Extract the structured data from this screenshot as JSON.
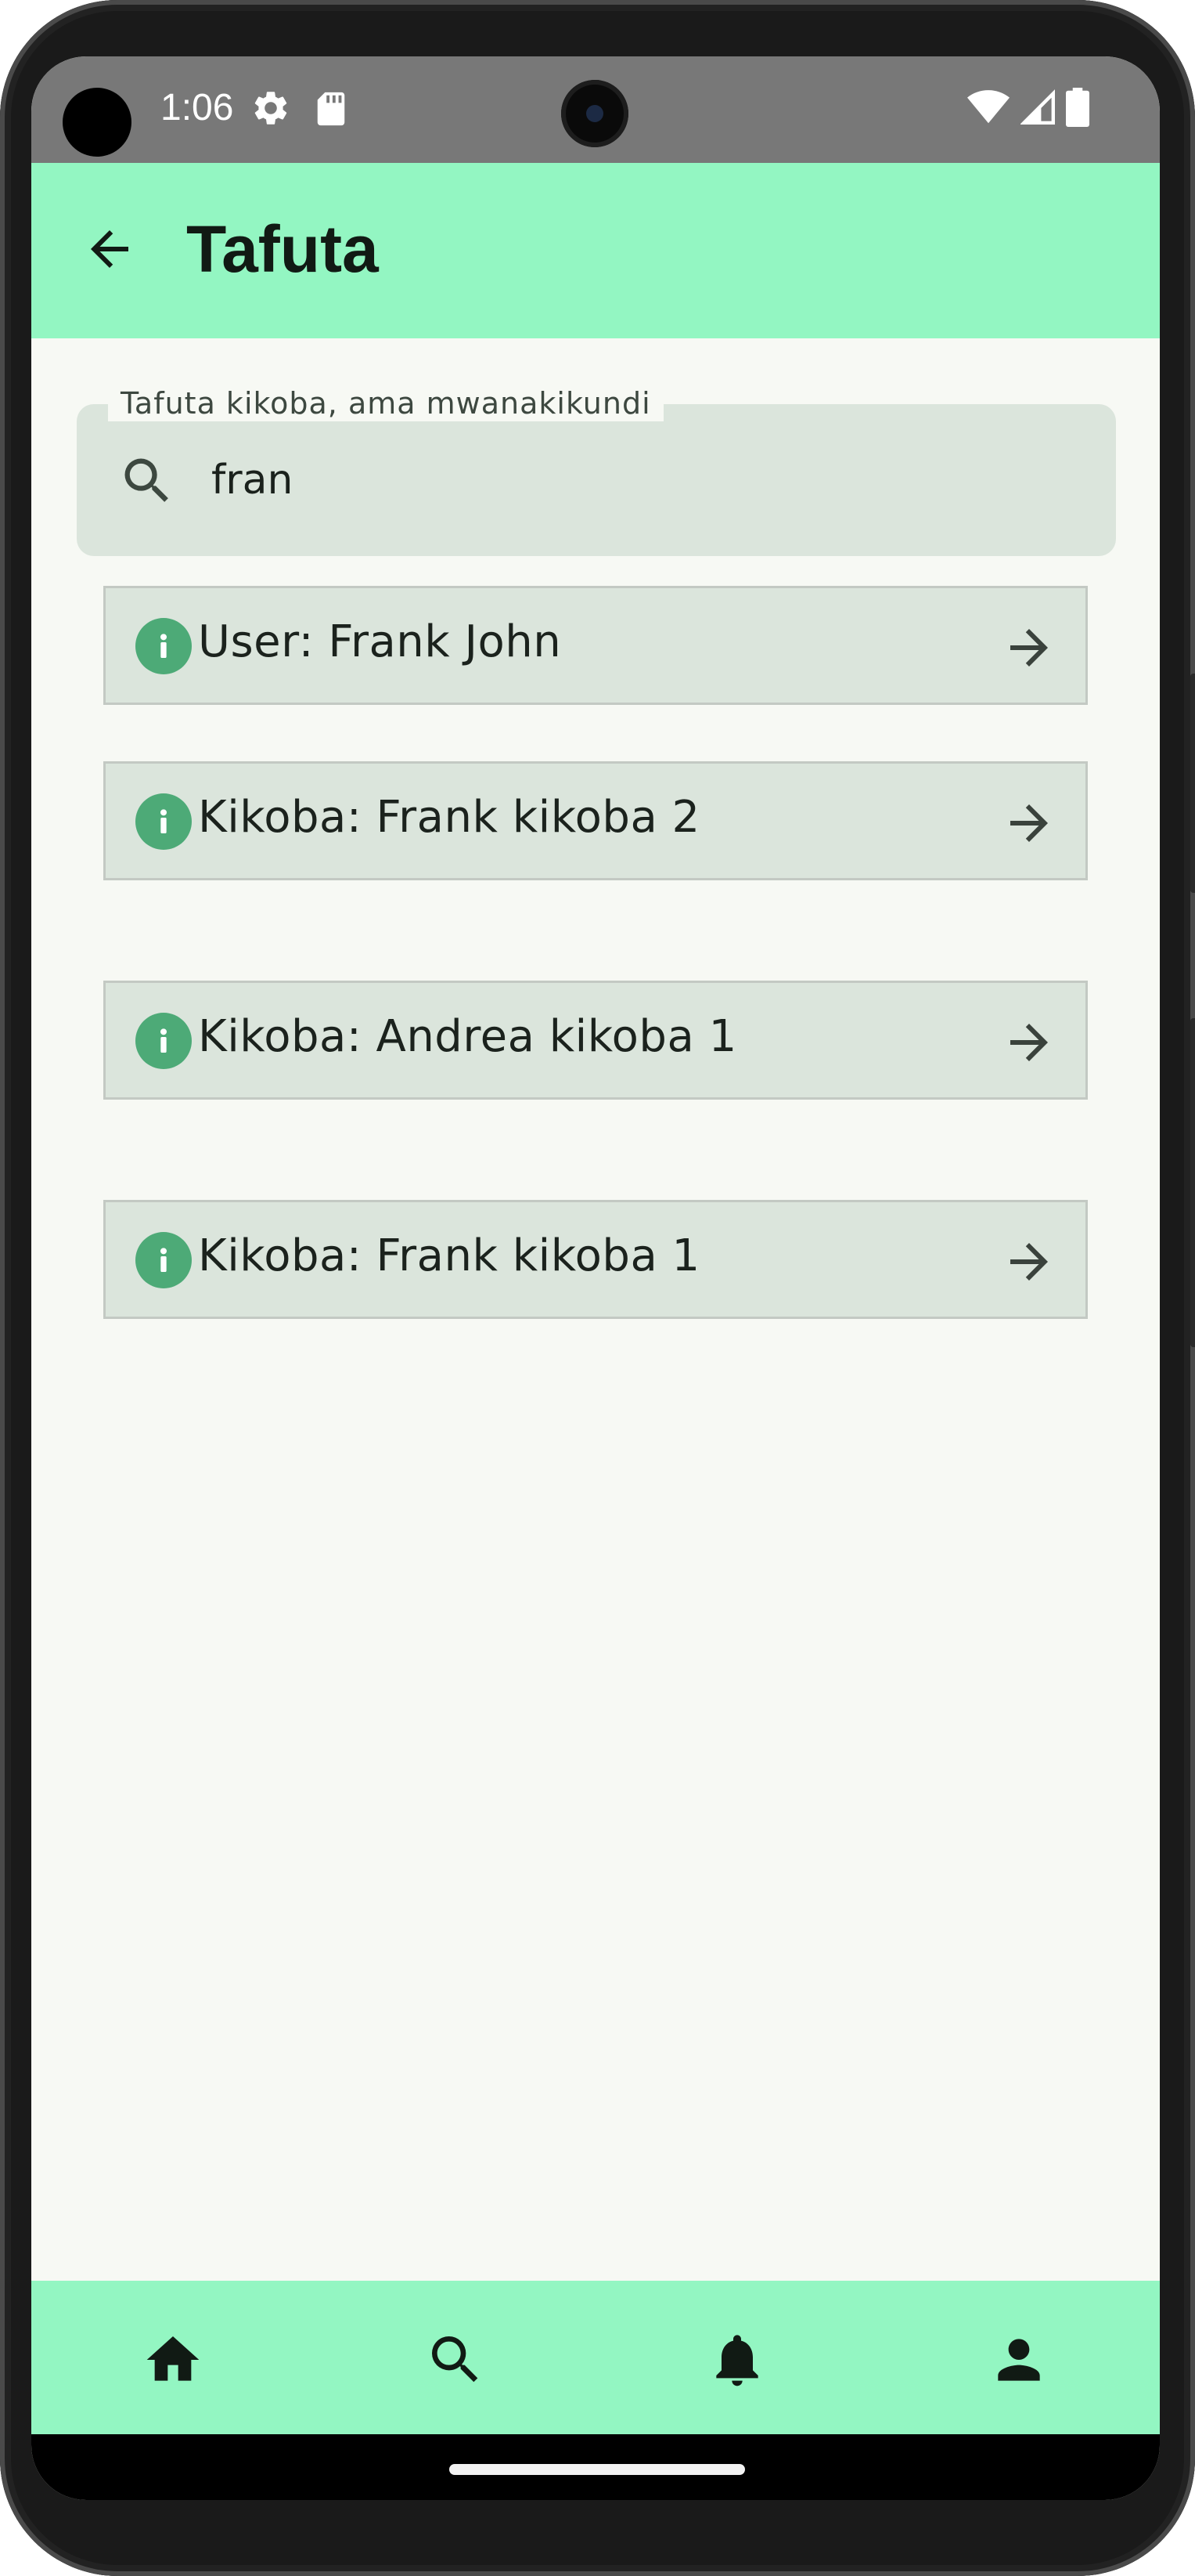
{
  "status_bar": {
    "time": "1:06",
    "icons": [
      "settings-gear-icon",
      "sd-card-icon",
      "wifi-icon",
      "cell-signal-icon",
      "battery-icon"
    ]
  },
  "app_bar": {
    "title": "Tafuta",
    "back_icon": "arrow-back-icon",
    "background_color": "#93f6c2"
  },
  "search": {
    "label": "Tafuta kikoba, ama mwanakikundi",
    "value": "fran",
    "icon": "search-icon"
  },
  "results": [
    {
      "label": "User: Frank John"
    },
    {
      "label": "Kikoba: Frank kikoba 2"
    },
    {
      "label": "Kikoba: Andrea kikoba 1"
    },
    {
      "label": "Kikoba: Frank kikoba 1"
    }
  ],
  "bottom_nav": {
    "items": [
      {
        "name": "home",
        "icon": "home-icon"
      },
      {
        "name": "search",
        "icon": "search-icon"
      },
      {
        "name": "notifications",
        "icon": "bell-icon"
      },
      {
        "name": "profile",
        "icon": "person-icon"
      }
    ]
  },
  "colors": {
    "accent": "#93f6c2",
    "info_icon": "#4daa77",
    "card_background": "#dbe5dc",
    "page_background": "#f7f9f4"
  }
}
